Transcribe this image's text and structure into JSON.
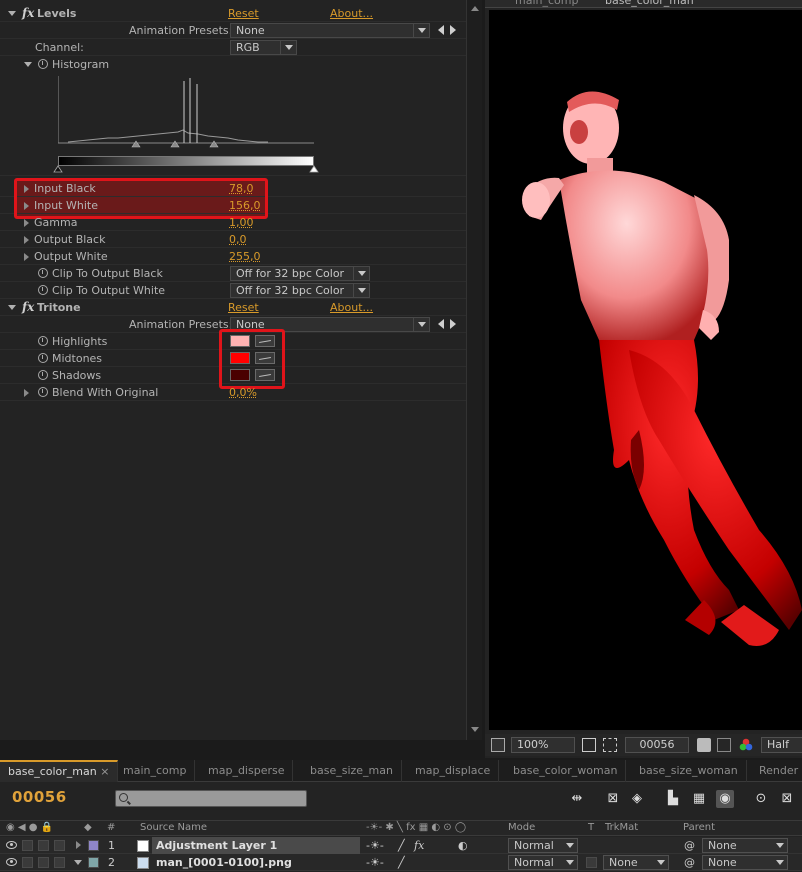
{
  "effects": {
    "levels": {
      "name": "Levels",
      "reset": "Reset",
      "about": "About...",
      "animation_presets_label": "Animation Presets:",
      "animation_presets_value": "None",
      "channel_label": "Channel:",
      "channel_value": "RGB",
      "histogram_label": "Histogram",
      "input_black_label": "Input Black",
      "input_black_value": "78,0",
      "input_white_label": "Input White",
      "input_white_value": "156,0",
      "gamma_label": "Gamma",
      "gamma_value": "1,00",
      "output_black_label": "Output Black",
      "output_black_value": "0,0",
      "output_white_label": "Output White",
      "output_white_value": "255,0",
      "clip_black_label": "Clip To Output Black",
      "clip_black_value": "Off for 32 bpc Color",
      "clip_white_label": "Clip To Output White",
      "clip_white_value": "Off for 32 bpc Color"
    },
    "tritone": {
      "name": "Tritone",
      "reset": "Reset",
      "about": "About...",
      "animation_presets_label": "Animation Presets:",
      "animation_presets_value": "None",
      "highlights_label": "Highlights",
      "highlights_color": "#ffb3b3",
      "midtones_label": "Midtones",
      "midtones_color": "#ff0000",
      "shadows_label": "Shadows",
      "shadows_color": "#4a0000",
      "blend_label": "Blend With Original",
      "blend_value": "0,0%"
    }
  },
  "viewer": {
    "tabs": [
      "main_comp",
      "base_color_man"
    ],
    "zoom": "100%",
    "timecode": "00056",
    "resolution": "Half"
  },
  "timeline": {
    "tabs": [
      "base_color_man",
      "main_comp",
      "map_disperse",
      "base_size_man",
      "map_displace",
      "base_color_woman",
      "base_size_woman",
      "Render"
    ],
    "active_tab": "base_color_man",
    "current_time": "00056",
    "columns": {
      "hash": "#",
      "source_name": "Source Name",
      "mode": "Mode",
      "t": "T",
      "trkmat": "TrkMat",
      "parent": "Parent"
    },
    "layers": [
      {
        "number": "1",
        "name": "Adjustment Layer 1",
        "mode": "Normal",
        "trkmat": "",
        "parent": "None",
        "label_color": "#8f86c8"
      },
      {
        "number": "2",
        "name": "man_[0001-0100].png",
        "mode": "Normal",
        "trkmat": "None",
        "parent": "None",
        "label_color": "#7fa6a8"
      }
    ]
  },
  "colors": {
    "accent": "#d89a2a",
    "highlight_box": "#e0141a"
  }
}
